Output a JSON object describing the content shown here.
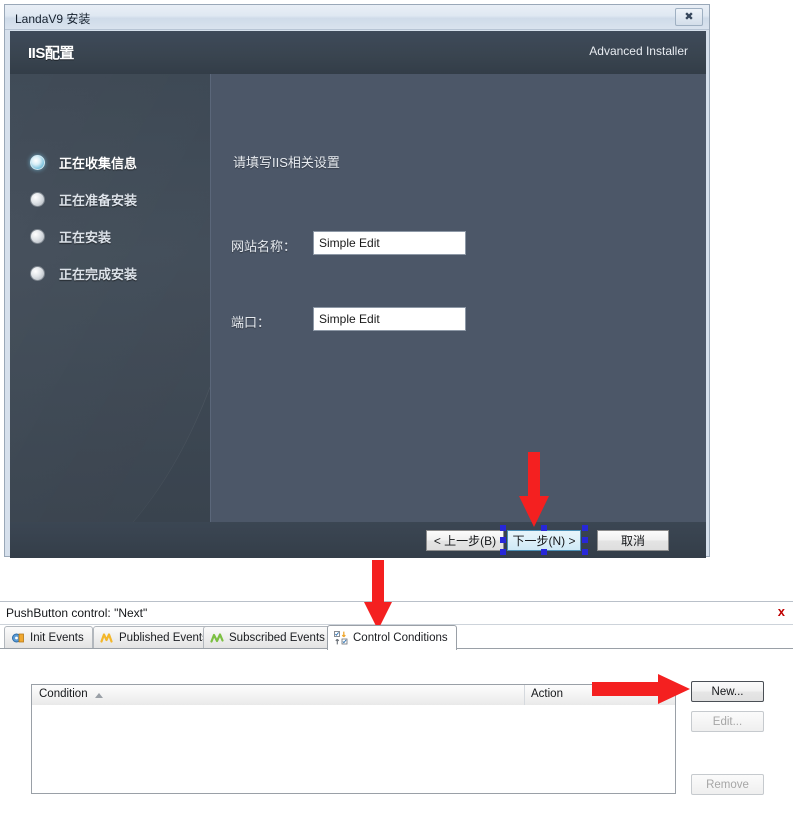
{
  "installer": {
    "window_title": "LandaV9 安装",
    "close_icon": "close-icon",
    "header": {
      "title": "IIS配置",
      "brand": "Advanced Installer"
    },
    "sidebar": {
      "steps": [
        {
          "label": "正在收集信息",
          "state": "active"
        },
        {
          "label": "正在准备安装",
          "state": "pending"
        },
        {
          "label": "正在安装",
          "state": "pending"
        },
        {
          "label": "正在完成安装",
          "state": "pending"
        }
      ]
    },
    "main": {
      "instruction": "请填写IIS相关设置",
      "fields": [
        {
          "label": "网站名称：",
          "value": "Simple Edit"
        },
        {
          "label": "端口：",
          "value": "Simple Edit"
        }
      ]
    },
    "footer": {
      "back_label": "< 上一步(B)",
      "next_label": "下一步(N) >",
      "cancel_label": "取消",
      "selected_button": "下一步(N) >",
      "selection_handle_color": "#2727d8"
    }
  },
  "properties_panel": {
    "title": "PushButton control: \"Next\"",
    "close_icon": "close-icon",
    "close_label": "x",
    "tabs": [
      {
        "label": "Init Events",
        "icon": "init-events-icon",
        "active": false
      },
      {
        "label": "Published Events",
        "icon": "published-events-icon",
        "active": false
      },
      {
        "label": "Subscribed Events",
        "icon": "subscribed-events-icon",
        "active": false
      },
      {
        "label": "Control Conditions",
        "icon": "control-conditions-icon",
        "active": true
      }
    ],
    "table": {
      "columns": [
        "Condition",
        "Action"
      ],
      "sort_column": "Condition",
      "sort_direction": "ascending",
      "rows": []
    },
    "buttons": [
      {
        "label": "New...",
        "enabled": true
      },
      {
        "label": "Edit...",
        "enabled": false
      },
      {
        "label": "Remove",
        "enabled": false
      }
    ]
  },
  "annotations": {
    "arrow_color": "#f42020",
    "arrows": [
      {
        "name": "arrow-to-next-button",
        "direction": "down",
        "target": "下一步(N) >"
      },
      {
        "name": "arrow-to-control-conditions-tab",
        "direction": "down",
        "target": "Control Conditions"
      },
      {
        "name": "arrow-to-new-button",
        "direction": "right",
        "target": "New..."
      }
    ]
  }
}
